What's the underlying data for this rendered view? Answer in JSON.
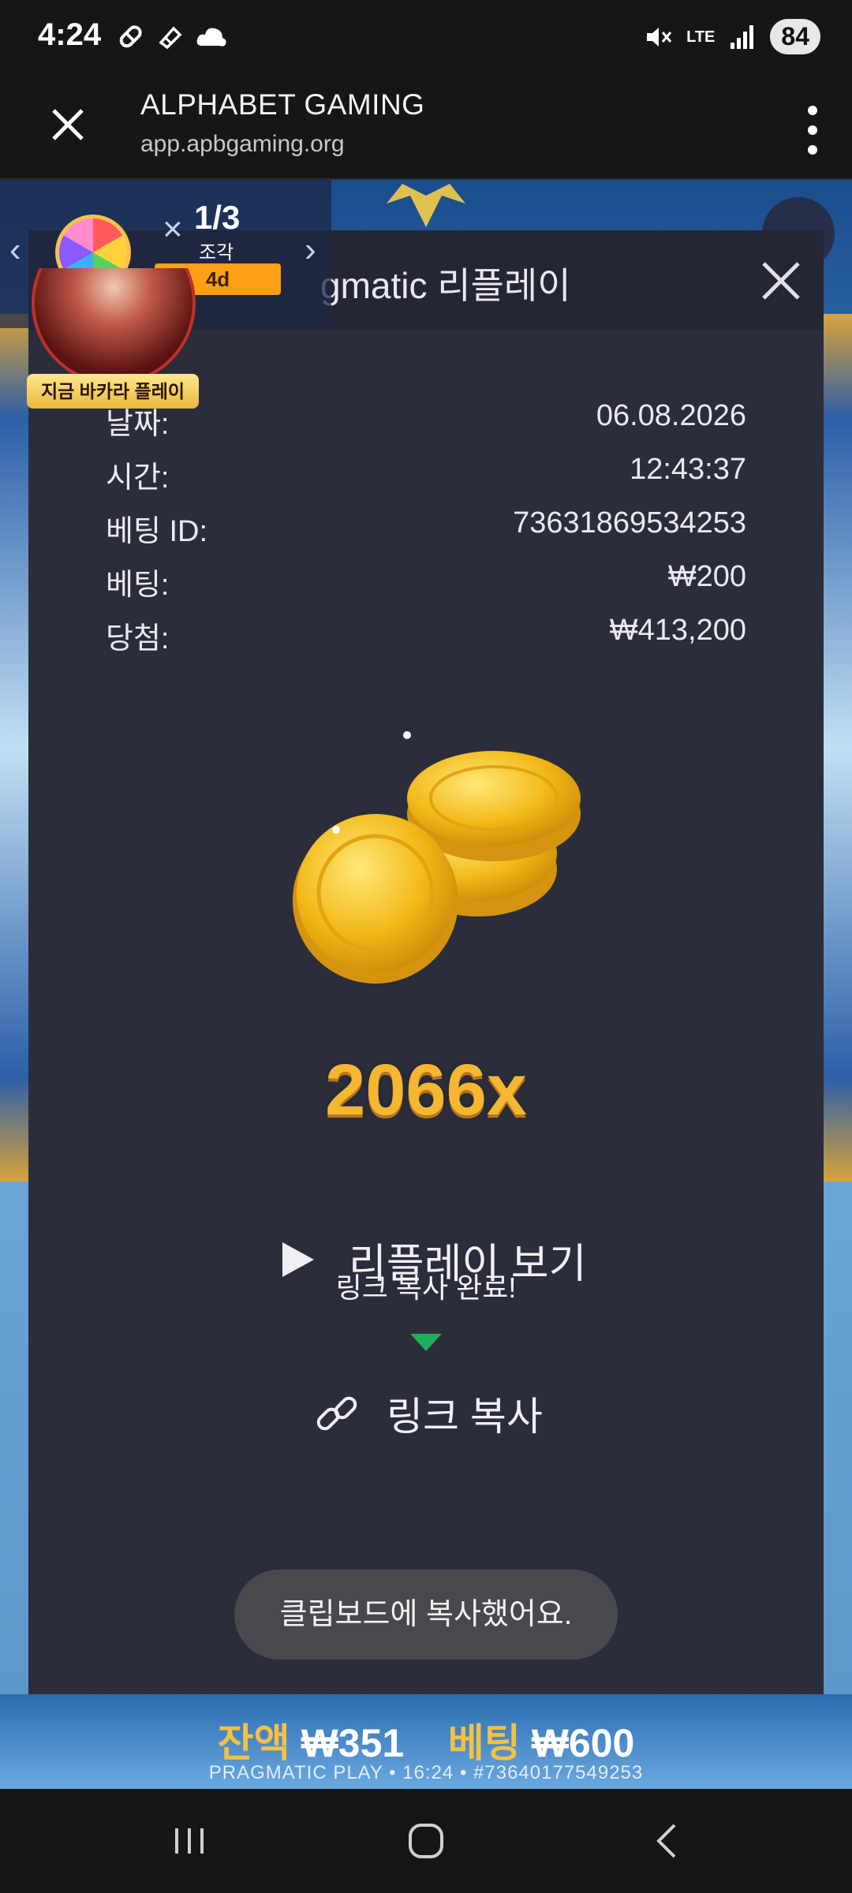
{
  "status_bar": {
    "time": "4:24",
    "left_icons": [
      "pill-icon",
      "eraser-icon",
      "cloud-icon"
    ],
    "right_icons": [
      "mute-icon",
      "lte-icon",
      "signal-icon"
    ],
    "network": "LTE",
    "battery": "84"
  },
  "browser": {
    "title": "ALPHABET GAMING",
    "url": "app.apbgaming.org"
  },
  "promo_widget": {
    "count": "1/3",
    "count_label": "조각",
    "timer": "4d",
    "play_label": "지금 바카라 플레이"
  },
  "modal": {
    "title": "gmatic 리플레이",
    "rows": [
      {
        "label": "날짜:",
        "value": "06.08.2026"
      },
      {
        "label": "시간:",
        "value": "12:43:37"
      },
      {
        "label": "베팅 ID:",
        "value": "73631869534253"
      },
      {
        "label": "베팅:",
        "value": "₩200"
      },
      {
        "label": "당첨:",
        "value": "₩413,200"
      }
    ],
    "multiplier": "2066x",
    "replay_label": "리플레이 보기",
    "copied_tip": "링크 복사 완료!",
    "link_label": "링크 복사"
  },
  "toast": "클립보드에 복사했어요.",
  "game_footer": {
    "balance_label": "잔액",
    "balance_value": "₩351",
    "bet_label": "베팅",
    "bet_value": "₩600",
    "meta": "PRAGMATIC PLAY • 16:24 • #73640177549253"
  },
  "colors": {
    "modal_bg": "#2c2d3b",
    "accent_gold": "#f5b731",
    "tip_green": "#1fae5a",
    "badge_orange": "#ff9f14"
  }
}
